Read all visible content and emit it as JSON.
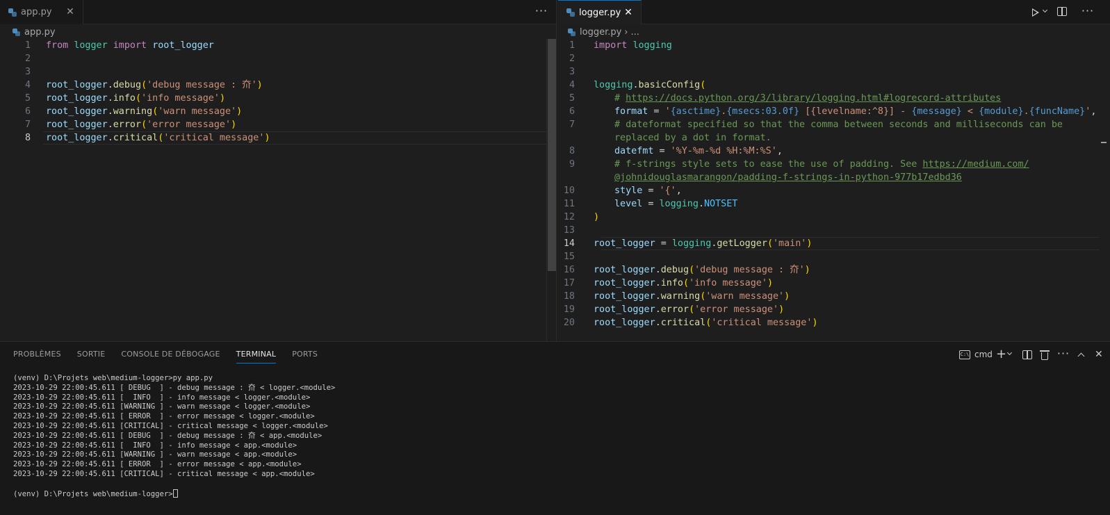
{
  "left_editor": {
    "tab": {
      "label": "app.py",
      "icon": "python-file-icon"
    },
    "breadcrumb": "app.py",
    "lines": [
      {
        "n": "1",
        "tokens": [
          [
            "kw",
            "from "
          ],
          [
            "mod",
            "logger "
          ],
          [
            "kw",
            "import "
          ],
          [
            "var",
            "root_logger"
          ]
        ]
      },
      {
        "n": "2",
        "tokens": []
      },
      {
        "n": "3",
        "tokens": []
      },
      {
        "n": "4",
        "tokens": [
          [
            "var",
            "root_logger"
          ],
          [
            "op",
            "."
          ],
          [
            "fn",
            "debug"
          ],
          [
            "br1",
            "("
          ],
          [
            "str",
            "'debug message : 夼'"
          ],
          [
            "br1",
            ")"
          ]
        ]
      },
      {
        "n": "5",
        "tokens": [
          [
            "var",
            "root_logger"
          ],
          [
            "op",
            "."
          ],
          [
            "fn",
            "info"
          ],
          [
            "br1",
            "("
          ],
          [
            "str",
            "'info message'"
          ],
          [
            "br1",
            ")"
          ]
        ]
      },
      {
        "n": "6",
        "tokens": [
          [
            "var",
            "root_logger"
          ],
          [
            "op",
            "."
          ],
          [
            "fn",
            "warning"
          ],
          [
            "br1",
            "("
          ],
          [
            "str",
            "'warn message'"
          ],
          [
            "br1",
            ")"
          ]
        ]
      },
      {
        "n": "7",
        "tokens": [
          [
            "var",
            "root_logger"
          ],
          [
            "op",
            "."
          ],
          [
            "fn",
            "error"
          ],
          [
            "br1",
            "("
          ],
          [
            "str",
            "'error message'"
          ],
          [
            "br1",
            ")"
          ]
        ]
      },
      {
        "n": "8",
        "tokens": [
          [
            "var",
            "root_logger"
          ],
          [
            "op",
            "."
          ],
          [
            "fn",
            "critical"
          ],
          [
            "br1",
            "("
          ],
          [
            "str",
            "'critical message'"
          ],
          [
            "br1",
            ")"
          ]
        ],
        "current": true
      }
    ]
  },
  "right_editor": {
    "tab": {
      "label": "logger.py",
      "icon": "python-file-icon"
    },
    "breadcrumb": "logger.py",
    "breadcrumb_more": "...",
    "lines": [
      {
        "n": "1",
        "tokens": [
          [
            "kw",
            "import "
          ],
          [
            "mod",
            "logging"
          ]
        ]
      },
      {
        "n": "2",
        "tokens": []
      },
      {
        "n": "3",
        "tokens": []
      },
      {
        "n": "4",
        "tokens": [
          [
            "mod",
            "logging"
          ],
          [
            "op",
            "."
          ],
          [
            "fn",
            "basicConfig"
          ],
          [
            "br1",
            "("
          ]
        ]
      },
      {
        "n": "5",
        "indent": true,
        "tokens": [
          [
            "cm",
            "# "
          ],
          [
            "lnk",
            "https://docs.python.org/3/library/logging.html#logrecord-attributes"
          ]
        ]
      },
      {
        "n": "6",
        "indent": true,
        "tokens": [
          [
            "var",
            "format"
          ],
          [
            "op",
            " = "
          ],
          [
            "str",
            "'"
          ],
          [
            "fmt",
            "{asctime}"
          ],
          [
            "str",
            "."
          ],
          [
            "fmt",
            "{msecs:03.0f}"
          ],
          [
            "str",
            " [{levelname:^8}] - "
          ],
          [
            "fmt",
            "{message}"
          ],
          [
            "str",
            " < "
          ],
          [
            "fmt",
            "{module}"
          ],
          [
            "str",
            "."
          ],
          [
            "fmt",
            "{funcName}"
          ],
          [
            "str",
            "'"
          ],
          [
            "op",
            ","
          ]
        ]
      },
      {
        "n": "7",
        "indent": true,
        "tokens": [
          [
            "cm",
            "# dateformat specified so that the comma between seconds and milliseconds can be"
          ]
        ]
      },
      {
        "n": "",
        "indent": true,
        "tokens": [
          [
            "cm",
            "replaced by a dot in format."
          ]
        ]
      },
      {
        "n": "8",
        "indent": true,
        "tokens": [
          [
            "var",
            "datefmt"
          ],
          [
            "op",
            " = "
          ],
          [
            "str",
            "'%Y-%m-%d %H:%M:%S'"
          ],
          [
            "op",
            ","
          ]
        ]
      },
      {
        "n": "9",
        "indent": true,
        "tokens": [
          [
            "cm",
            "# f-strings style sets to ease the use of padding. See "
          ],
          [
            "lnk",
            "https://medium.com/"
          ]
        ]
      },
      {
        "n": "",
        "indent": true,
        "tokens": [
          [
            "lnk",
            "@johnidouglasmarangon/padding-f-strings-in-python-977b17edbd36"
          ]
        ]
      },
      {
        "n": "10",
        "indent": true,
        "tokens": [
          [
            "var",
            "style"
          ],
          [
            "op",
            " = "
          ],
          [
            "str",
            "'{'"
          ],
          [
            "op",
            ","
          ]
        ]
      },
      {
        "n": "11",
        "indent": true,
        "tokens": [
          [
            "var",
            "level"
          ],
          [
            "op",
            " = "
          ],
          [
            "mod",
            "logging"
          ],
          [
            "op",
            "."
          ],
          [
            "const",
            "NOTSET"
          ]
        ]
      },
      {
        "n": "12",
        "tokens": [
          [
            "br1",
            ")"
          ]
        ]
      },
      {
        "n": "13",
        "tokens": []
      },
      {
        "n": "14",
        "tokens": [
          [
            "var",
            "root_logger"
          ],
          [
            "op",
            " = "
          ],
          [
            "mod",
            "logging"
          ],
          [
            "op",
            "."
          ],
          [
            "fn",
            "getLogger"
          ],
          [
            "br1",
            "("
          ],
          [
            "str",
            "'main'"
          ],
          [
            "br1",
            ")"
          ]
        ],
        "current": true
      },
      {
        "n": "15",
        "tokens": []
      },
      {
        "n": "16",
        "tokens": [
          [
            "var",
            "root_logger"
          ],
          [
            "op",
            "."
          ],
          [
            "fn",
            "debug"
          ],
          [
            "br1",
            "("
          ],
          [
            "str",
            "'debug message : 夼'"
          ],
          [
            "br1",
            ")"
          ]
        ]
      },
      {
        "n": "17",
        "tokens": [
          [
            "var",
            "root_logger"
          ],
          [
            "op",
            "."
          ],
          [
            "fn",
            "info"
          ],
          [
            "br1",
            "("
          ],
          [
            "str",
            "'info message'"
          ],
          [
            "br1",
            ")"
          ]
        ]
      },
      {
        "n": "18",
        "tokens": [
          [
            "var",
            "root_logger"
          ],
          [
            "op",
            "."
          ],
          [
            "fn",
            "warning"
          ],
          [
            "br1",
            "("
          ],
          [
            "str",
            "'warn message'"
          ],
          [
            "br1",
            ")"
          ]
        ]
      },
      {
        "n": "19",
        "tokens": [
          [
            "var",
            "root_logger"
          ],
          [
            "op",
            "."
          ],
          [
            "fn",
            "error"
          ],
          [
            "br1",
            "("
          ],
          [
            "str",
            "'error message'"
          ],
          [
            "br1",
            ")"
          ]
        ]
      },
      {
        "n": "20",
        "tokens": [
          [
            "var",
            "root_logger"
          ],
          [
            "op",
            "."
          ],
          [
            "fn",
            "critical"
          ],
          [
            "br1",
            "("
          ],
          [
            "str",
            "'critical message'"
          ],
          [
            "br1",
            ")"
          ]
        ]
      }
    ]
  },
  "panel": {
    "tabs": [
      {
        "label": "PROBLÈMES",
        "active": false
      },
      {
        "label": "SORTIE",
        "active": false
      },
      {
        "label": "CONSOLE DE DÉBOGAGE",
        "active": false
      },
      {
        "label": "TERMINAL",
        "active": true
      },
      {
        "label": "PORTS",
        "active": false
      }
    ],
    "shell_label": "cmd",
    "terminal_lines": [
      "(venv) D:\\Projets web\\medium-logger>py app.py",
      "2023-10-29 22:00:45.611 [ DEBUG  ] - debug message : 夼 < logger.<module>",
      "2023-10-29 22:00:45.611 [  INFO  ] - info message < logger.<module>",
      "2023-10-29 22:00:45.611 [WARNING ] - warn message < logger.<module>",
      "2023-10-29 22:00:45.611 [ ERROR  ] - error message < logger.<module>",
      "2023-10-29 22:00:45.611 [CRITICAL] - critical message < logger.<module>",
      "2023-10-29 22:00:45.611 [ DEBUG  ] - debug message : 夼 < app.<module>",
      "2023-10-29 22:00:45.611 [  INFO  ] - info message < app.<module>",
      "2023-10-29 22:00:45.611 [WARNING ] - warn message < app.<module>",
      "2023-10-29 22:00:45.611 [ ERROR  ] - error message < app.<module>",
      "2023-10-29 22:00:45.611 [CRITICAL] - critical message < app.<module>",
      "",
      "(venv) D:\\Projets web\\medium-logger>"
    ]
  },
  "colors": {
    "editor_bg": "#1e1e1e",
    "tabbar_bg": "#181818",
    "accent": "#0078d4",
    "keyword": "#c586c0",
    "module": "#4ec9b0",
    "variable": "#9cdcfe",
    "function": "#dcdcaa",
    "string": "#ce9178",
    "comment": "#6a9955"
  }
}
